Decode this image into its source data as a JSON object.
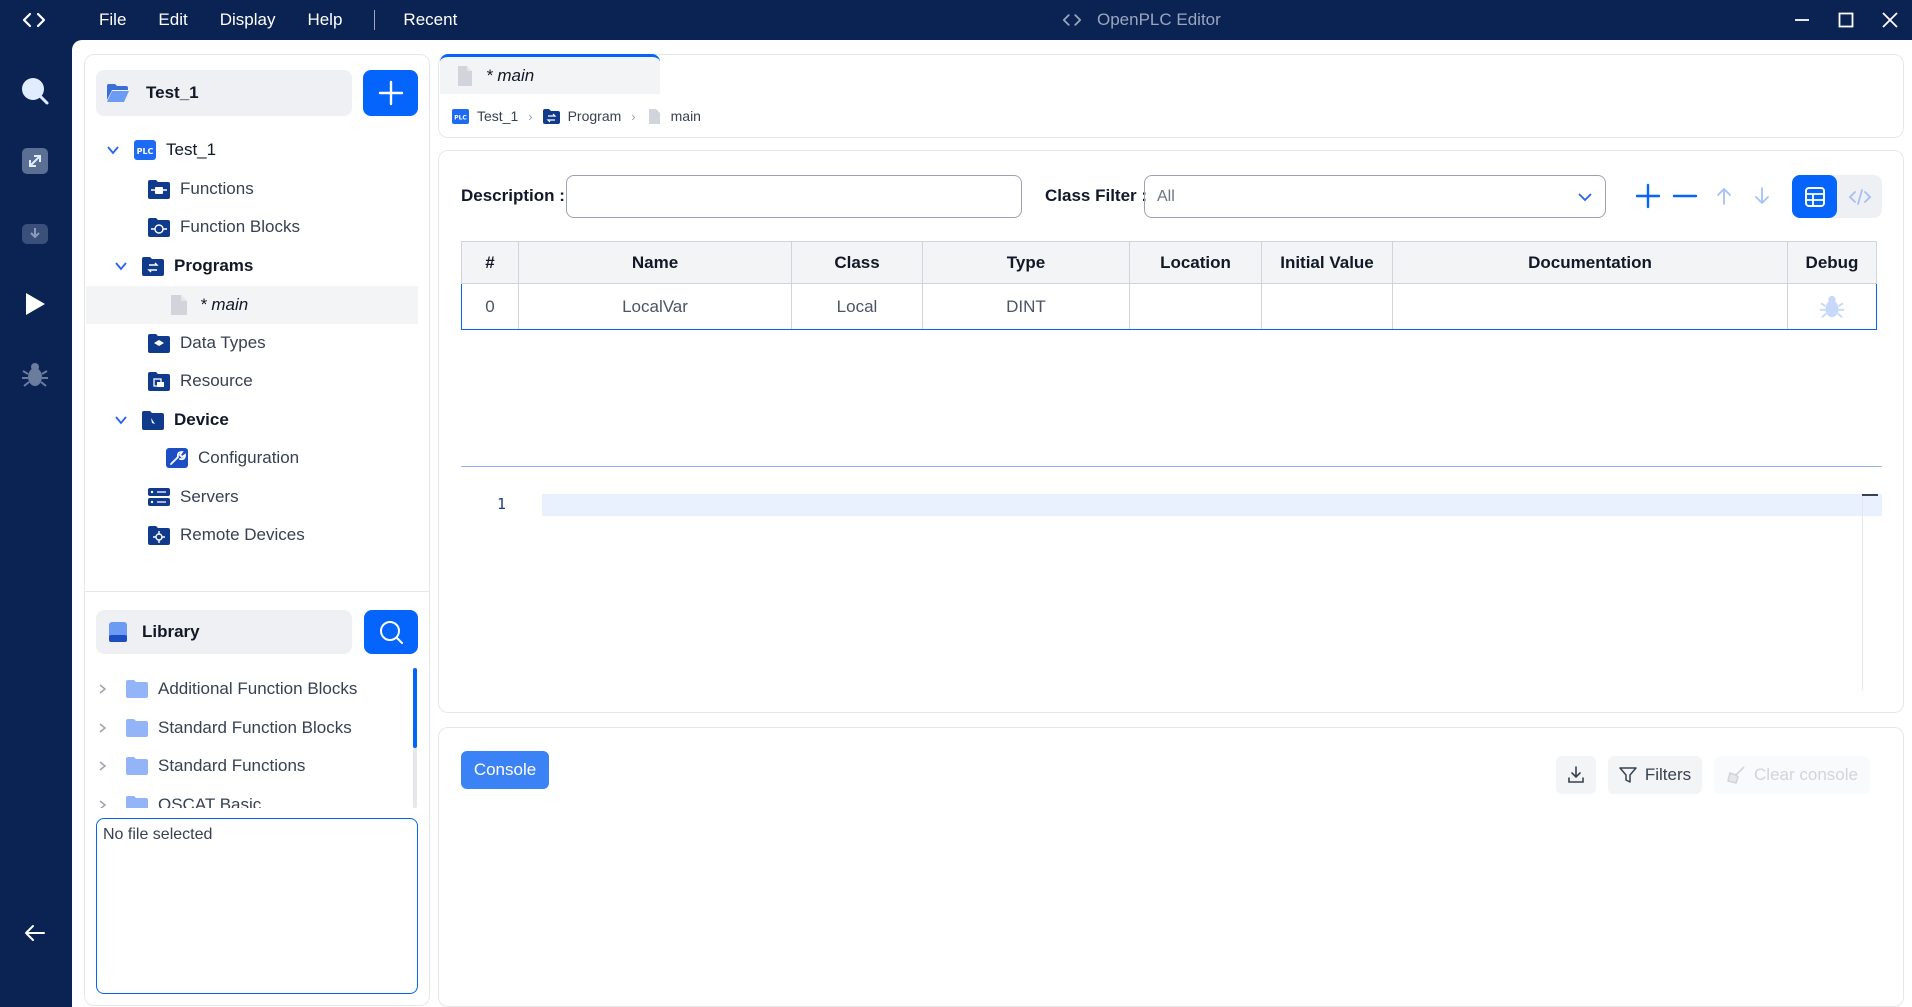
{
  "window": {
    "title": "OpenPLC Editor",
    "menu": [
      "File",
      "Edit",
      "Display",
      "Help",
      "Recent"
    ]
  },
  "explorer": {
    "project_name": "Test_1",
    "tree": {
      "root": "Test_1",
      "functions": "Functions",
      "function_blocks": "Function Blocks",
      "programs": "Programs",
      "main": "* main",
      "data_types": "Data Types",
      "resource": "Resource",
      "device": "Device",
      "configuration": "Configuration",
      "servers": "Servers",
      "remote_devices": "Remote Devices"
    },
    "plc_badge": "PLC"
  },
  "library": {
    "title": "Library",
    "items": [
      "Additional Function Blocks",
      "Standard Function Blocks",
      "Standard Functions",
      "OSCAT Basic"
    ],
    "file_info": "No file selected"
  },
  "editor": {
    "tab_label": "* main",
    "breadcrumb": [
      "Test_1",
      "Program",
      "main"
    ],
    "description_label": "Description :",
    "description_value": "",
    "class_filter_label": "Class Filter :",
    "class_filter_value": "All",
    "table": {
      "headers": [
        "#",
        "Name",
        "Class",
        "Type",
        "Location",
        "Initial Value",
        "Documentation",
        "Debug"
      ],
      "rows": [
        {
          "index": "0",
          "name": "LocalVar",
          "class": "Local",
          "type": "DINT",
          "location": "",
          "initial_value": "",
          "documentation": ""
        }
      ]
    },
    "code_line_number": "1"
  },
  "console": {
    "tab_label": "Console",
    "filters_label": "Filters",
    "clear_label": "Clear console"
  },
  "colors": {
    "navy": "#0b2352",
    "accent": "#0464fb",
    "console_tab": "#3b82f6"
  }
}
